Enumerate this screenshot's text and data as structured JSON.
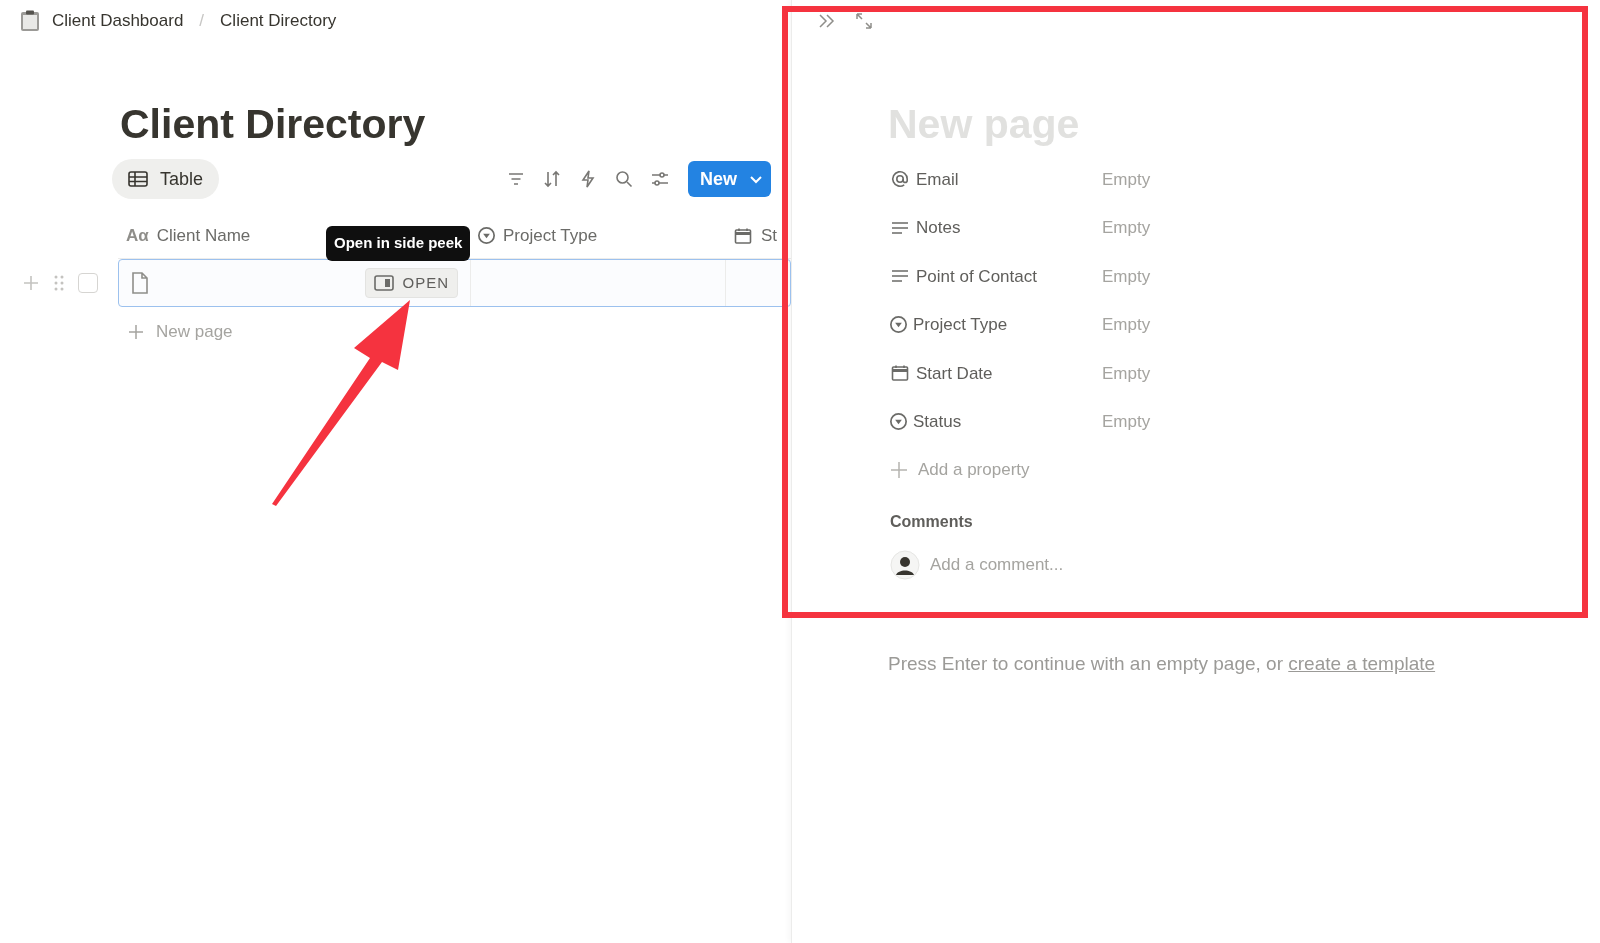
{
  "breadcrumb": {
    "items": [
      {
        "label": "Client Dashboard"
      },
      {
        "label": "Client Directory"
      }
    ],
    "separator": "/"
  },
  "title": "Client Directory",
  "views": [
    {
      "label": "Table",
      "selected": true
    }
  ],
  "new_button": "New",
  "columns": [
    {
      "kind": "title",
      "label": "Client Name",
      "icon_text": "Aα"
    },
    {
      "kind": "select",
      "label": "Project Type"
    },
    {
      "kind": "date",
      "label": "St"
    }
  ],
  "rows": [
    {
      "checked": false,
      "open_button": "OPEN"
    }
  ],
  "tooltip": "Open in side peek",
  "new_row": "New page",
  "side_peek": {
    "title": "New page",
    "properties": [
      {
        "kind": "email",
        "label": "Email",
        "value": "Empty"
      },
      {
        "kind": "text",
        "label": "Notes",
        "value": "Empty"
      },
      {
        "kind": "text",
        "label": "Point of Contact",
        "value": "Empty"
      },
      {
        "kind": "select",
        "label": "Project Type",
        "value": "Empty"
      },
      {
        "kind": "date",
        "label": "Start Date",
        "value": "Empty"
      },
      {
        "kind": "select",
        "label": "Status",
        "value": "Empty"
      }
    ],
    "add_property": "Add a property",
    "comments_heading": "Comments",
    "comment_placeholder": "Add a comment...",
    "hint": {
      "text": "Press Enter to continue with an empty page, or ",
      "link": "create a template"
    }
  }
}
